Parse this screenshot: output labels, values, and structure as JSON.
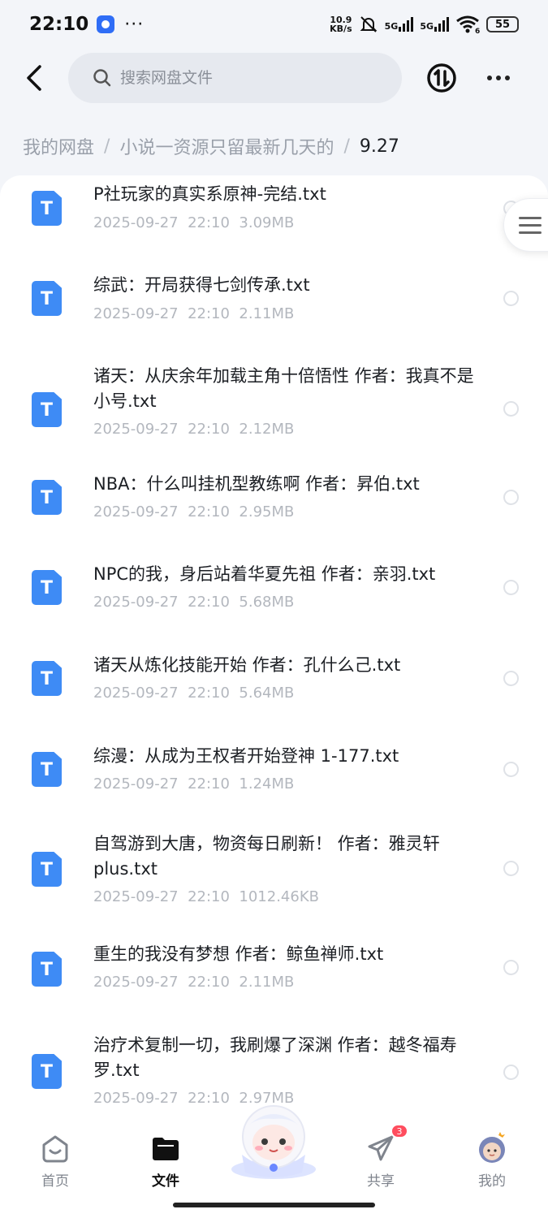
{
  "status_bar": {
    "time": "22:10",
    "net_speed_value": "10.9",
    "net_speed_unit": "KB/s",
    "signal1": "5G",
    "signal2": "5G",
    "wifi_level": "6",
    "battery": "55"
  },
  "header": {
    "search_placeholder": "搜索网盘文件"
  },
  "breadcrumb": {
    "items": [
      "我的网盘",
      "小说一资源只留最新几天的",
      "9.27"
    ],
    "separator": "/"
  },
  "files": [
    {
      "name": "P社玩家的真实系原神-完结.txt",
      "date": "2025-09-27",
      "time": "22:10",
      "size": "3.09MB",
      "icon": "T"
    },
    {
      "name": "综武：开局获得七剑传承.txt",
      "date": "2025-09-27",
      "time": "22:10",
      "size": "2.11MB",
      "icon": "T"
    },
    {
      "name": "诸天：从庆余年加载主角十倍悟性 作者：我真不是小号.txt",
      "date": "2025-09-27",
      "time": "22:10",
      "size": "2.12MB",
      "icon": "T"
    },
    {
      "name": "NBA：什么叫挂机型教练啊 作者：昇伯.txt",
      "date": "2025-09-27",
      "time": "22:10",
      "size": "2.95MB",
      "icon": "T"
    },
    {
      "name": "NPC的我，身后站着华夏先祖 作者：亲羽.txt",
      "date": "2025-09-27",
      "time": "22:10",
      "size": "5.68MB",
      "icon": "T"
    },
    {
      "name": "诸天从炼化技能开始 作者：孔什么己.txt",
      "date": "2025-09-27",
      "time": "22:10",
      "size": "5.64MB",
      "icon": "T"
    },
    {
      "name": "综漫：从成为王权者开始登神 1-177.txt",
      "date": "2025-09-27",
      "time": "22:10",
      "size": "1.24MB",
      "icon": "T"
    },
    {
      "name": "自驾游到大唐，物资每日刷新！ 作者：雅灵轩plus.txt",
      "date": "2025-09-27",
      "time": "22:10",
      "size": "1012.46KB",
      "icon": "T"
    },
    {
      "name": "重生的我没有梦想 作者：鲸鱼禅师.txt",
      "date": "2025-09-27",
      "time": "22:10",
      "size": "2.11MB",
      "icon": "T"
    },
    {
      "name": "治疗术复制一切，我刷爆了深渊 作者：越冬福寿罗.txt",
      "date": "2025-09-27",
      "time": "22:10",
      "size": "2.97MB",
      "icon": "T"
    }
  ],
  "bottom_nav": {
    "items": [
      {
        "label": "首页",
        "icon": "home-icon",
        "active": false
      },
      {
        "label": "文件",
        "icon": "folder-icon",
        "active": true
      },
      {
        "label": "共享",
        "icon": "send-icon",
        "active": false,
        "badge": "3"
      },
      {
        "label": "我的",
        "icon": "avatar-icon",
        "active": false
      }
    ]
  },
  "colors": {
    "accent": "#3e8bf5",
    "badge": "#ff4d5e",
    "background": "#f3f5f9"
  }
}
